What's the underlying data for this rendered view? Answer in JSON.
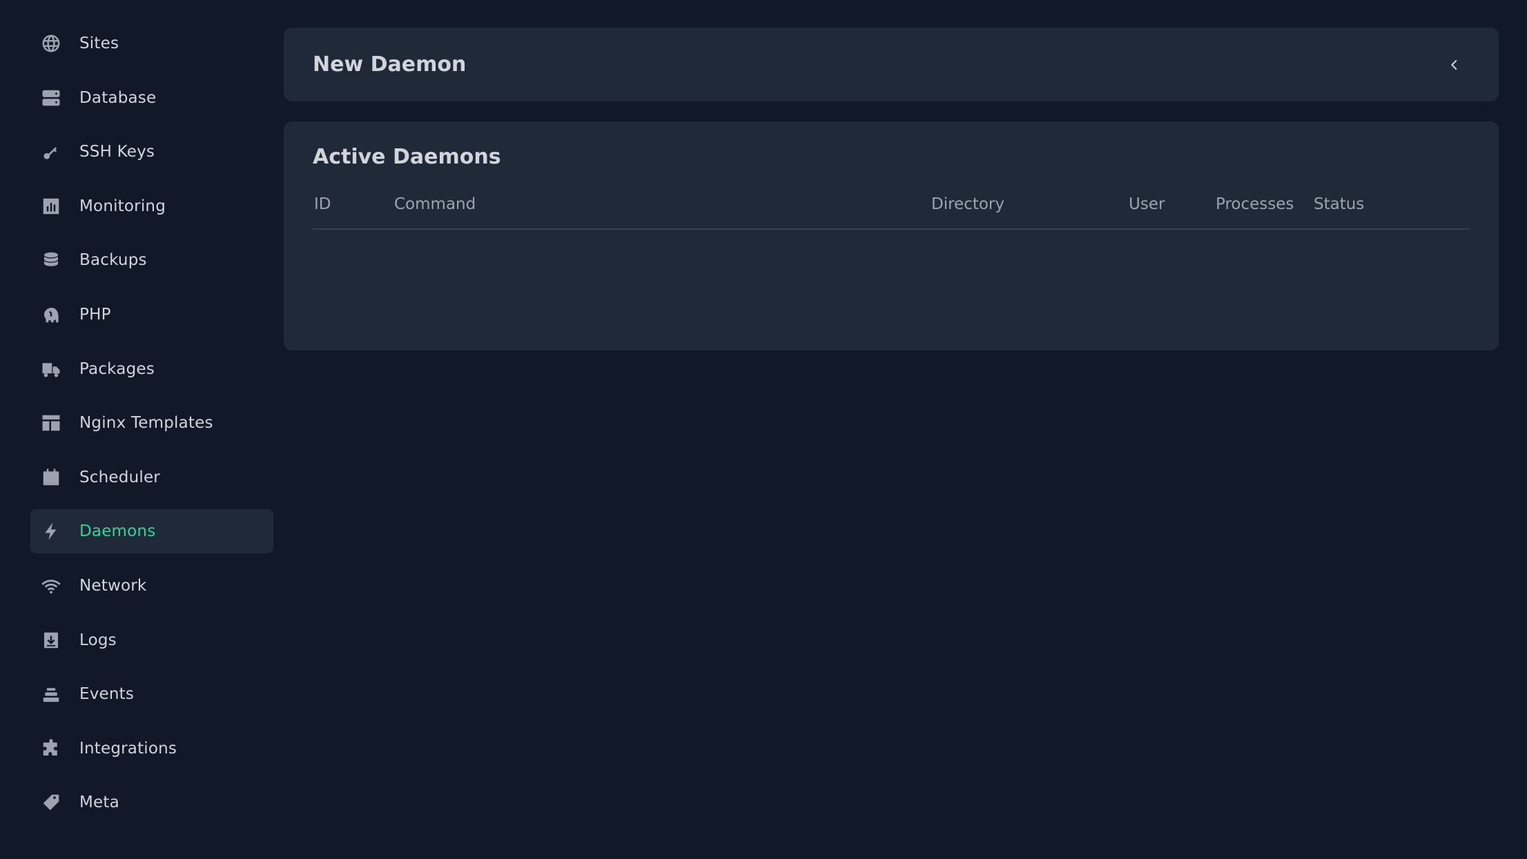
{
  "sidebar": {
    "items": [
      {
        "label": "Sites",
        "icon": "globe-icon"
      },
      {
        "label": "Database",
        "icon": "database-icon"
      },
      {
        "label": "SSH Keys",
        "icon": "key-icon"
      },
      {
        "label": "Monitoring",
        "icon": "chart-icon"
      },
      {
        "label": "Backups",
        "icon": "backup-icon"
      },
      {
        "label": "PHP",
        "icon": "php-elephant-icon"
      },
      {
        "label": "Packages",
        "icon": "truck-icon"
      },
      {
        "label": "Nginx Templates",
        "icon": "template-icon"
      },
      {
        "label": "Scheduler",
        "icon": "calendar-icon"
      },
      {
        "label": "Daemons",
        "icon": "bolt-icon",
        "active": true
      },
      {
        "label": "Network",
        "icon": "wifi-icon"
      },
      {
        "label": "Logs",
        "icon": "logs-icon"
      },
      {
        "label": "Events",
        "icon": "events-icon"
      },
      {
        "label": "Integrations",
        "icon": "puzzle-icon"
      },
      {
        "label": "Meta",
        "icon": "tag-icon"
      }
    ],
    "active_color": "#34d399"
  },
  "new_daemon": {
    "title": "New Daemon",
    "toggle_icon": "chevron-left-icon"
  },
  "active_daemons": {
    "title": "Active Daemons",
    "columns": [
      "ID",
      "Command",
      "Directory",
      "User",
      "Processes",
      "Status"
    ],
    "rows": []
  }
}
